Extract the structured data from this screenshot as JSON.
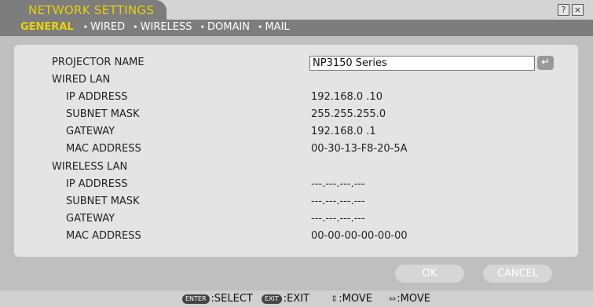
{
  "window": {
    "title": "NETWORK SETTINGS",
    "help_icon": "?",
    "close_icon": "×"
  },
  "tabs": [
    {
      "label": "GENERAL"
    },
    {
      "label": "WIRED"
    },
    {
      "label": "WIRELESS"
    },
    {
      "label": "DOMAIN"
    },
    {
      "label": "MAIL"
    }
  ],
  "tab_bullet": "•",
  "general": {
    "projector_name_label": "PROJECTOR NAME",
    "projector_name_value": "NP3150 Series",
    "enter_icon": "↵",
    "wired_lan": {
      "heading": "WIRED LAN",
      "ip_label": "IP ADDRESS",
      "ip_value": "192.168.0 .10",
      "subnet_label": "SUBNET MASK",
      "subnet_value": "255.255.255.0",
      "gateway_label": "GATEWAY",
      "gateway_value": "192.168.0 .1",
      "mac_label": "MAC ADDRESS",
      "mac_value": "00-30-13-F8-20-5A"
    },
    "wireless_lan": {
      "heading": "WIRELESS LAN",
      "ip_label": "IP ADDRESS",
      "ip_value": "---.---.---.---",
      "subnet_label": "SUBNET MASK",
      "subnet_value": "---.---.---.---",
      "gateway_label": "GATEWAY",
      "gateway_value": "---.---.---.---",
      "mac_label": "MAC ADDRESS",
      "mac_value": "00-00-00-00-00-00"
    }
  },
  "buttons": {
    "ok": "OK",
    "cancel": "CANCEL"
  },
  "footer": {
    "enter_key": "ENTER",
    "select": ":SELECT",
    "exit_key": "EXIT",
    "exit": ":EXIT",
    "updown_glyph": "⇕",
    "move1": ":MOVE",
    "leftright_glyph": "⇔",
    "move2": ":MOVE"
  },
  "colors": {
    "title_text": "#e9d10a",
    "active_tab": "#e9d10a",
    "tab_strip": "#7d7d7d",
    "panel": "#e4e4e4"
  }
}
